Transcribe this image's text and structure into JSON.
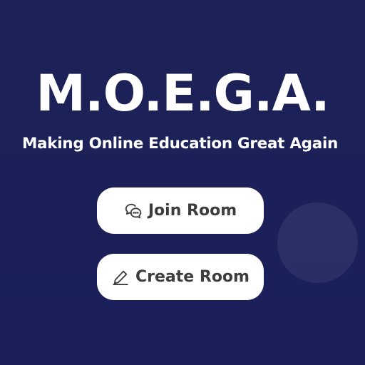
{
  "hero": {
    "title": "M.O.E.G.A.",
    "subtitle": "Making Online Education Great Again"
  },
  "actions": {
    "join": {
      "label": "Join Room",
      "icon": "chat-bubbles-icon"
    },
    "create": {
      "label": "Create Room",
      "icon": "pencil-icon"
    }
  },
  "colors": {
    "background": "#1d2356",
    "button_bg": "#ffffff",
    "button_text": "#3d3d3d",
    "title_text": "#ffffff"
  }
}
